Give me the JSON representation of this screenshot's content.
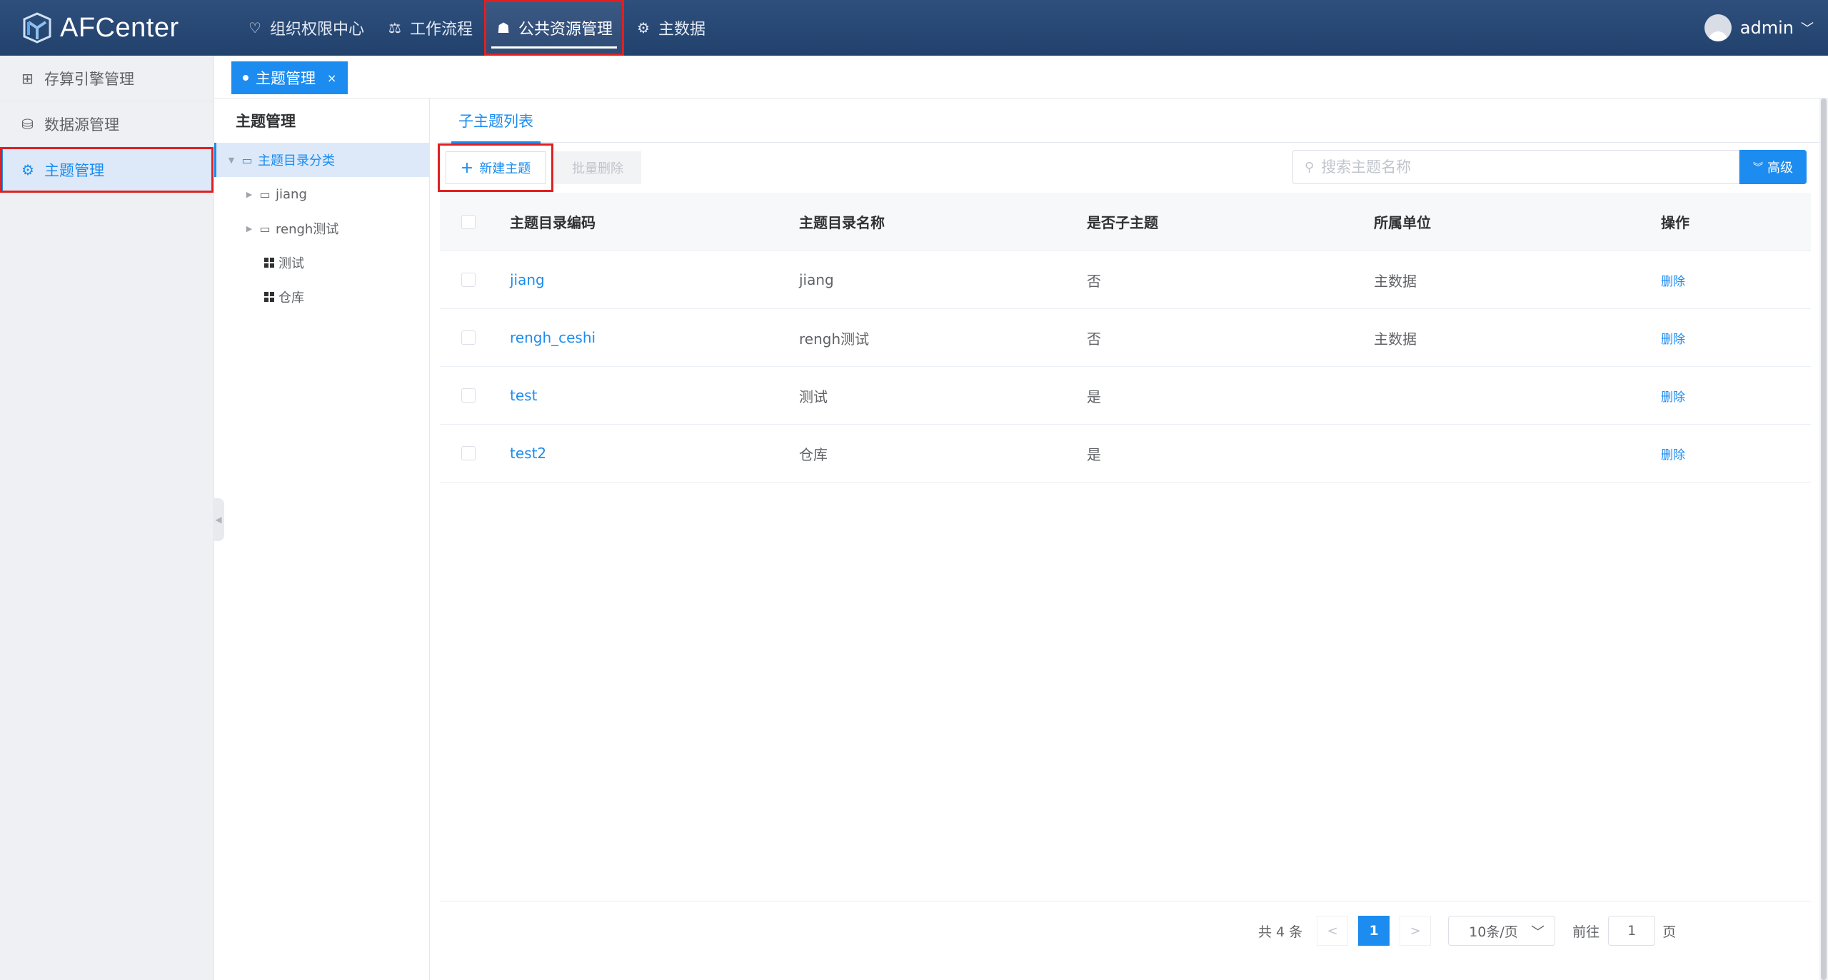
{
  "app": {
    "name": "AFCenter"
  },
  "nav": [
    {
      "label": "组织权限中心",
      "icon": "heart-shield-icon"
    },
    {
      "label": "工作流程",
      "icon": "scale-icon"
    },
    {
      "label": "公共资源管理",
      "icon": "users-icon"
    },
    {
      "label": "主数据",
      "icon": "sliders-icon"
    }
  ],
  "user": {
    "name": "admin"
  },
  "sidebar": {
    "items": [
      {
        "label": "存算引擎管理",
        "icon": "grid-icon"
      },
      {
        "label": "数据源管理",
        "icon": "database-icon"
      },
      {
        "label": "主题管理",
        "icon": "sliders-icon"
      }
    ]
  },
  "page_tab": {
    "label": "主题管理",
    "close": "×"
  },
  "tree": {
    "title": "主题管理",
    "root": "主题目录分类",
    "children": [
      {
        "label": "jiang",
        "type": "folder"
      },
      {
        "label": "rengh测试",
        "type": "folder"
      },
      {
        "label": "测试",
        "type": "leaf"
      },
      {
        "label": "仓库",
        "type": "leaf"
      }
    ]
  },
  "main": {
    "subtab": "子主题列表",
    "toolbar": {
      "new_label": "新建主题",
      "batch_delete_label": "批量删除",
      "search_placeholder": "搜索主题名称",
      "advanced_label": "高级"
    },
    "table": {
      "columns": [
        "主题目录编码",
        "主题目录名称",
        "是否子主题",
        "所属单位",
        "操作"
      ],
      "rows": [
        {
          "code": "jiang",
          "name": "jiang",
          "is_sub": "否",
          "unit": "主数据",
          "action": "删除"
        },
        {
          "code": "rengh_ceshi",
          "name": "rengh测试",
          "is_sub": "否",
          "unit": "主数据",
          "action": "删除"
        },
        {
          "code": "test",
          "name": "测试",
          "is_sub": "是",
          "unit": "",
          "action": "删除"
        },
        {
          "code": "test2",
          "name": "仓库",
          "is_sub": "是",
          "unit": "",
          "action": "删除"
        }
      ]
    },
    "pagination": {
      "total": "共 4 条",
      "prev": "<",
      "current": "1",
      "next": ">",
      "page_size": "10条/页",
      "goto_label": "前往",
      "goto_value": "1",
      "page_suffix": "页"
    }
  },
  "colors": {
    "accent": "#1c8cf0",
    "header": "#22416d",
    "highlight": "#e02020"
  }
}
